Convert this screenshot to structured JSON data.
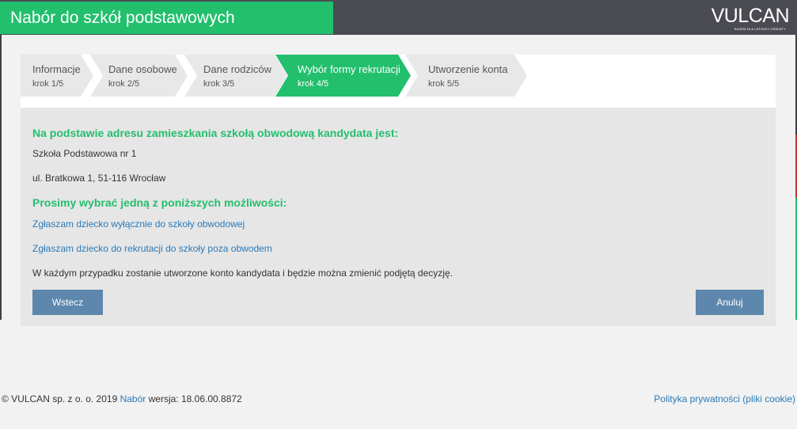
{
  "header": {
    "title": "Nabór do szkół podstawowych",
    "logo": "VULCAN",
    "logo_tagline": "RAZEM DLA LEPSZEJ OŚWIATY",
    "accent_color": "#22bf6d",
    "bar_color": "#4a4a52"
  },
  "steps": [
    {
      "name": "Informacje",
      "num": "krok 1/5",
      "active": false
    },
    {
      "name": "Dane osobowe",
      "num": "krok 2/5",
      "active": false
    },
    {
      "name": "Dane rodziców",
      "num": "krok 3/5",
      "active": false
    },
    {
      "name": "Wybór formy rekrutacji",
      "num": "krok 4/5",
      "active": true
    },
    {
      "name": "Utworzenie konta",
      "num": "krok 5/5",
      "active": false
    }
  ],
  "content": {
    "district_heading": "Na podstawie adresu zamieszkania szkołą obwodową kandydata jest:",
    "school_name": "Szkoła Podstawowa nr 1",
    "school_address": "ul. Bratkowa 1, 51-116 Wrocław",
    "choice_heading": "Prosimy wybrać jedną z poniższych możliwości:",
    "option_district_only": "Zgłaszam dziecko wyłącznie do szkoły obwodowej",
    "option_outside_district": "Zgłaszam dziecko do rekrutacji do szkoły poza obwodem",
    "note": "W każdym przypadku zostanie utworzone konto kandydata i będzie można zmienić podjętą decyzję."
  },
  "buttons": {
    "back": "Wstecz",
    "cancel": "Anuluj"
  },
  "footer": {
    "copyright": "© VULCAN sp. z o. o. 2019",
    "app_link": "Nabór",
    "version": "wersja: 18.06.00.8872",
    "privacy_link": "Polityka prywatności (pliki cookie)"
  }
}
